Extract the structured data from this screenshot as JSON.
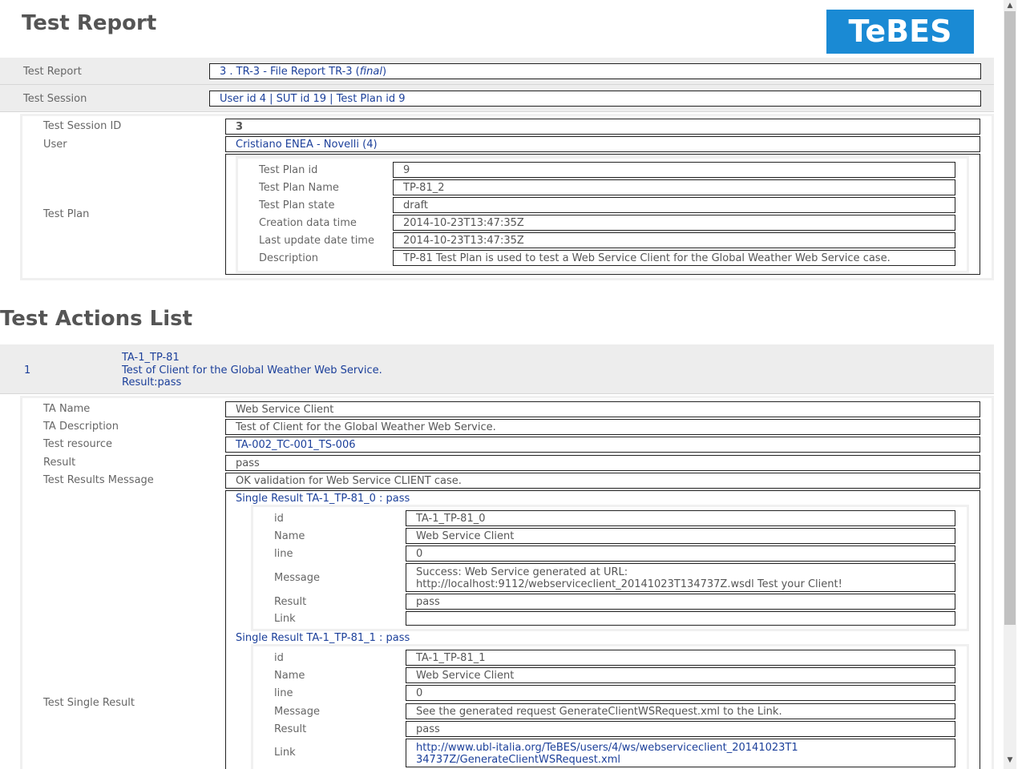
{
  "header": {
    "title": "Test Report",
    "logo": "TeBES"
  },
  "report": {
    "test_report_label": "Test Report",
    "test_report_value_main": "3 . TR-3 - File Report TR-3 (",
    "test_report_value_italic": "final",
    "test_report_value_close": ")",
    "test_session_label": "Test Session",
    "test_session_value": "User id 4 | SUT id 19 | Test Plan id 9",
    "session_id_label": "Test Session ID",
    "session_id_value": "3",
    "user_label": "User",
    "user_value": "Cristiano ENEA - Novelli (4)",
    "test_plan_label": "Test Plan",
    "test_plan": [
      {
        "label": "Test Plan id",
        "value": "9"
      },
      {
        "label": "Test Plan Name",
        "value": "TP-81_2"
      },
      {
        "label": "Test Plan state",
        "value": "draft"
      },
      {
        "label": "Creation data time",
        "value": "2014-10-23T13:47:35Z"
      },
      {
        "label": "Last update date time",
        "value": "2014-10-23T13:47:35Z"
      },
      {
        "label": "Description",
        "value": "TP-81 Test Plan is used to test a Web Service Client for the Global Weather Web Service case."
      }
    ]
  },
  "actions": {
    "title": "Test Actions List",
    "item": {
      "number": "1",
      "id": "TA-1_TP-81",
      "desc": "Test of Client for the Global Weather Web Service.",
      "result": "Result:pass"
    },
    "fields": [
      {
        "label": "TA Name",
        "value": "Web Service Client"
      },
      {
        "label": "TA Description",
        "value": "Test of Client for the Global Weather Web Service."
      },
      {
        "label": "Test resource",
        "value": "TA-002_TC-001_TS-006"
      },
      {
        "label": "Result",
        "value": "pass"
      },
      {
        "label": "Test Results Message",
        "value": "OK validation for Web Service CLIENT case."
      }
    ],
    "single_result_label": "Test Single Result",
    "single_results": [
      {
        "title": "Single Result TA-1_TP-81_0 : pass",
        "id_label": "id",
        "id": "TA-1_TP-81_0",
        "name_label": "Name",
        "name": "Web Service Client",
        "line_label": "line",
        "line": "0",
        "message_label": "Message",
        "message_1": "Success: Web Service generated at URL:",
        "message_2": "http://localhost:9112/webserviceclient_20141023T134737Z.wsdl Test your Client!",
        "result_label": "Result",
        "result": "pass",
        "link_label": "Link",
        "link": ""
      },
      {
        "title": "Single Result TA-1_TP-81_1 : pass",
        "id_label": "id",
        "id": "TA-1_TP-81_1",
        "name_label": "Name",
        "name": "Web Service Client",
        "line_label": "line",
        "line": "0",
        "message_label": "Message",
        "message_1": "See the generated request GenerateClientWSRequest.xml to the Link.",
        "result_label": "Result",
        "result": "pass",
        "link_label": "Link",
        "link_1": "http://www.ubl-italia.org/TeBES/users/4/ws/webserviceclient_20141023T1",
        "link_2": "34737Z/GenerateClientWSRequest.xml"
      }
    ]
  }
}
